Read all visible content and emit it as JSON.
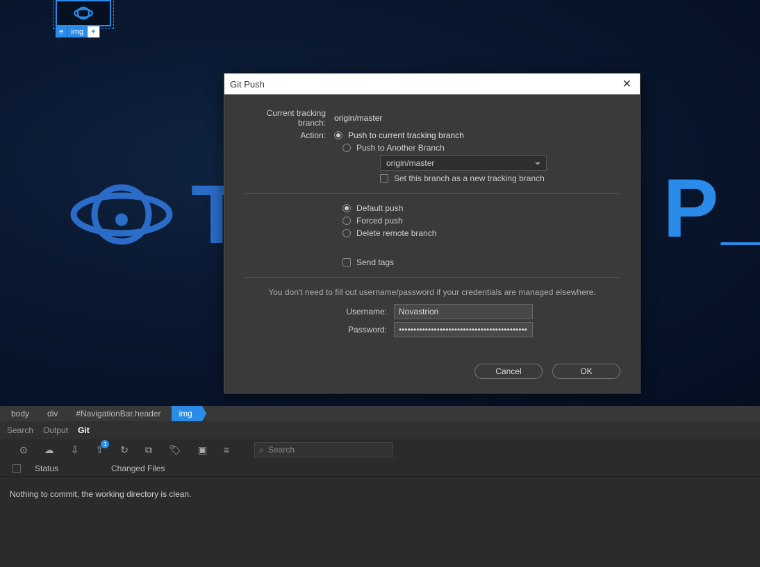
{
  "selection": {
    "tag": "img"
  },
  "dialog": {
    "title": "Git Push",
    "tracking_label": "Current tracking branch:",
    "tracking_value": "origin/master",
    "action_label": "Action:",
    "radio_push_current": "Push to current tracking branch",
    "radio_push_another": "Push to Another Branch",
    "branch_select": "origin/master",
    "checkbox_new_tracking": "Set this branch as a new tracking branch",
    "radio_default_push": "Default push",
    "radio_forced_push": "Forced push",
    "radio_delete_remote": "Delete remote branch",
    "checkbox_send_tags": "Send tags",
    "credentials_note": "You don't need to fill out username/password if your credentials are managed elsewhere.",
    "username_label": "Username:",
    "username_value": "Novastrion",
    "password_label": "Password:",
    "password_value": "••••••••••••••••••••••••••••••••••••••••••••",
    "cancel": "Cancel",
    "ok": "OK"
  },
  "breadcrumbs": {
    "b0": "body",
    "b1": "div",
    "b2": "#NavigationBar.header",
    "b3": "img"
  },
  "panel_tabs": {
    "search": "Search",
    "output": "Output",
    "git": "Git"
  },
  "git_toolbar": {
    "search_placeholder": "Search",
    "push_badge": "1"
  },
  "git_panel": {
    "col_status": "Status",
    "col_changed": "Changed Files",
    "empty_message": "Nothing to commit, the working directory is clean."
  }
}
